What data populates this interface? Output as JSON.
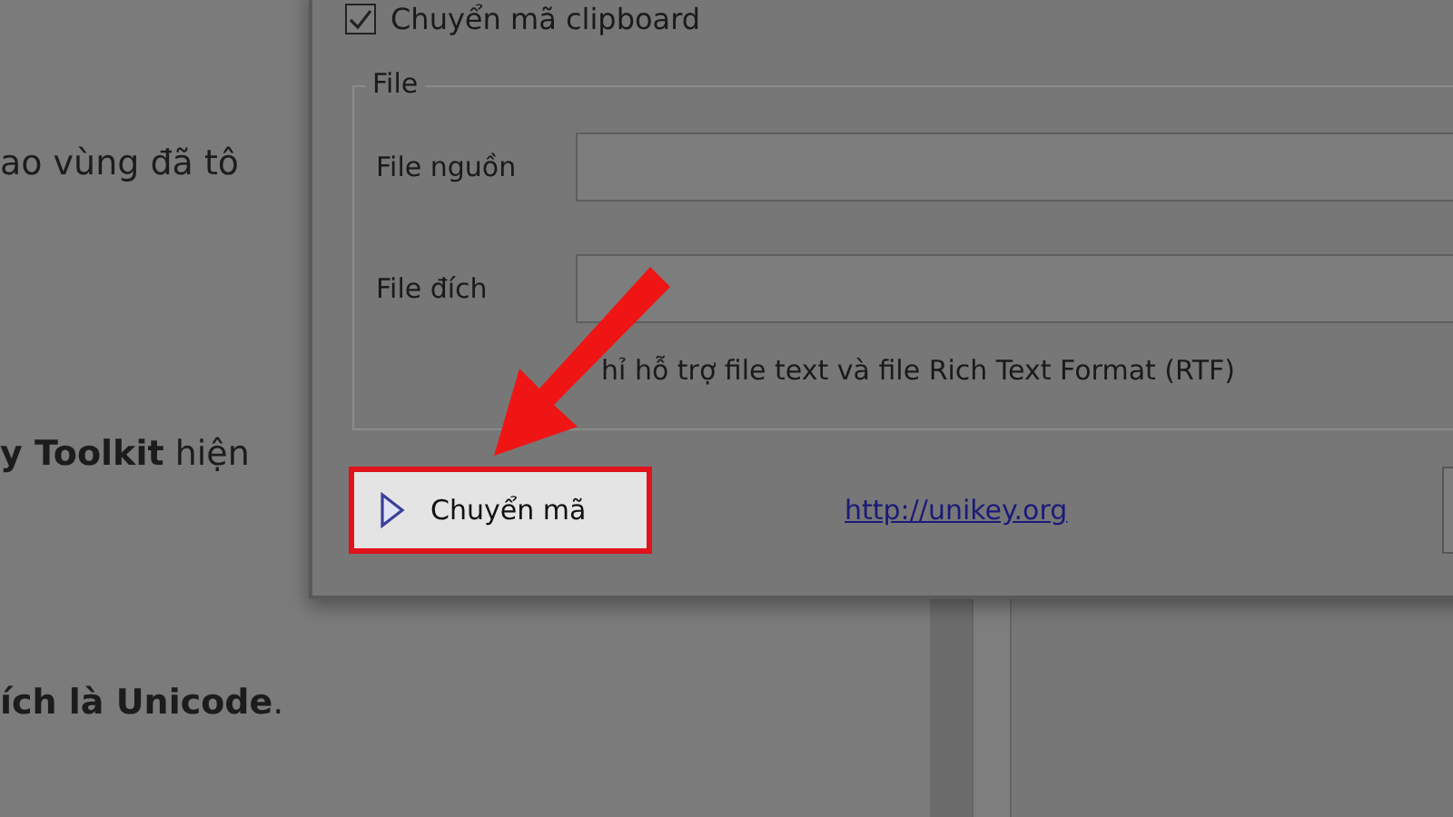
{
  "background_page": {
    "paragraphs": [
      "ao vùng đã tô",
      "**y Toolkit** hiện",
      "**ích là Unicode**."
    ]
  },
  "dialog": {
    "clipboard_option": {
      "label": "Chuyển mã clipboard",
      "checked": true
    },
    "file_group": {
      "title": "File",
      "fields": [
        {
          "label": "File nguồn"
        },
        {
          "label": "File đích"
        }
      ],
      "note": "hỉ hỗ trợ file text và file Rich Text Format (RTF)"
    },
    "convert_button": {
      "label": "Chuyển mã",
      "highlighted": true
    },
    "link": "http://unikey.org"
  }
}
